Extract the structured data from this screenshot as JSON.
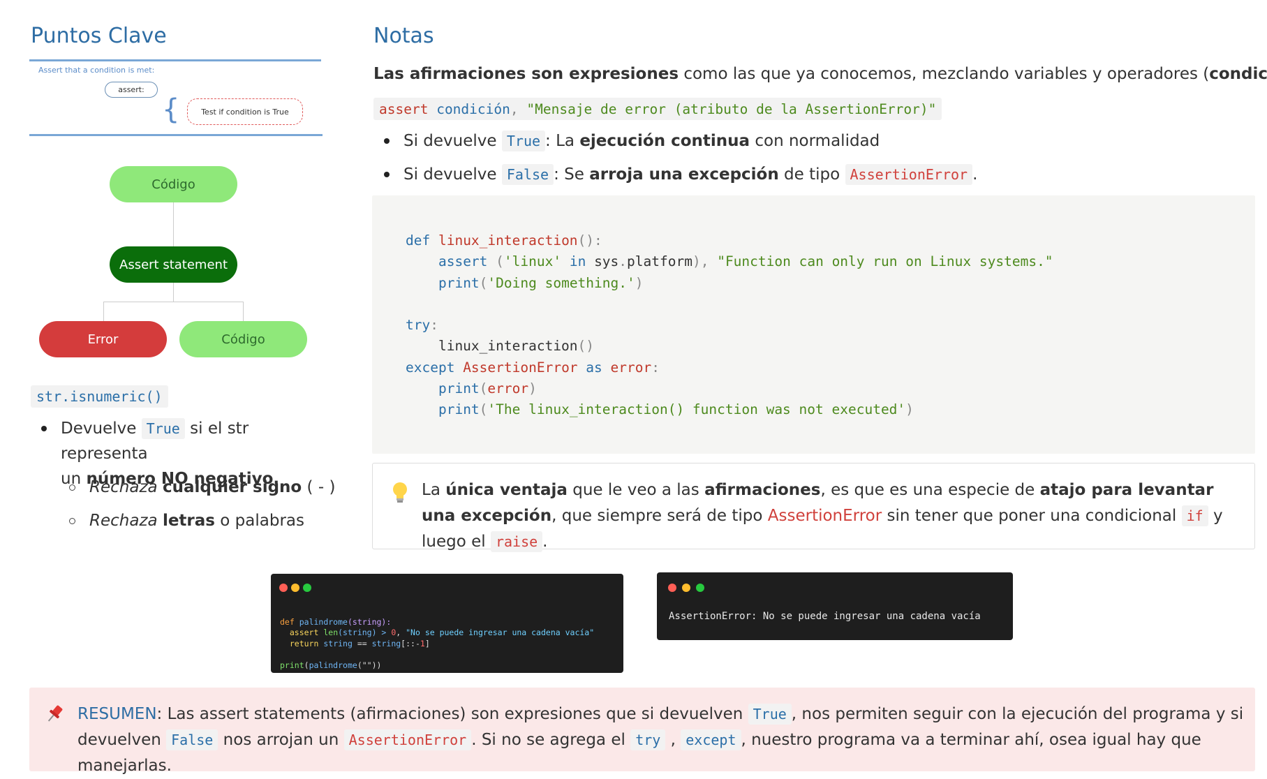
{
  "left": {
    "heading": "Puntos Clave",
    "diagram_top": {
      "caption": "Assert that a condition is met:",
      "assert_pill": "assert:",
      "brace": "{",
      "condition_box": "Test if condition is True"
    },
    "flow": {
      "top_node": "Código",
      "middle_node": "Assert statement",
      "left_node": "Error",
      "right_node": "Código"
    },
    "method": "str.isnumeric()",
    "bullet1": {
      "pre": "Devuelve",
      "code": "True",
      "post": "si el str representa",
      "line2_pre": "un",
      "line2_bold": "número NO negativo."
    },
    "sub1": {
      "italic": "Rechaza",
      "bold": "cualquier signo",
      "rest": "( - )"
    },
    "sub2": {
      "italic": "Rechaza",
      "bold": "letras",
      "rest": "o palabras"
    }
  },
  "right": {
    "heading": "Notas",
    "intro": {
      "bold1": "Las afirmaciones son expresiones",
      "text1": "como las que ya conocemos, mezclando variables y operadores (",
      "bold2": "condiciones",
      "text2": ")."
    },
    "syntax": {
      "kw": "assert",
      "cond": "condición",
      "comma": ",",
      "msg": "\"Mensaje de error (atributo de la AssertionError)\""
    },
    "bullet_true": {
      "pre": "Si devuelve",
      "code": "True",
      "colon": ": La",
      "bold": "ejecución continua",
      "post": "con normalidad"
    },
    "bullet_false": {
      "pre": "Si devuelve",
      "code": "False",
      "colon": ": Se",
      "bold": "arroja una excepción",
      "mid": "de tipo",
      "code2": "AssertionError",
      "post": "."
    },
    "tip": {
      "icon": "lightbulb-icon",
      "t1": "La",
      "b1": "única ventaja",
      "t2": "que le veo a las",
      "b2": "afirmaciones",
      "t3": ", es que es una especie de",
      "b3": "atajo para levantar una excepción",
      "t4": ",",
      "t5": "que siempre será de tipo",
      "red": "AssertionError",
      "t6": "sin tener que poner una condicional",
      "code1": "if",
      "t7": "y luego el",
      "code2": "raise",
      "t8": "."
    }
  },
  "terminal1": {
    "l1a": "def",
    "l1b": "palindrome",
    "l1c": "(string):",
    "l2a": "assert",
    "l2b": "len",
    "l2c": "(string) >",
    "l2d": "0",
    "l2e": ",",
    "l2f": "\"No se puede ingresar una cadena vacía\"",
    "l3a": "return",
    "l3b": "string",
    "l3c": "==",
    "l3d": "string",
    "l3e": "[::-",
    "l3f": "1",
    "l3g": "]",
    "l4a": "print",
    "l4b": "(",
    "l4c": "palindrome",
    "l4d": "(\"\"))"
  },
  "terminal2": {
    "output": "AssertionError: No se puede ingresar una cadena vacía"
  },
  "summary": {
    "icon": "pushpin-icon",
    "label": "RESUMEN",
    "t1": ": Las assert statements (afirmaciones) son expresiones que si devuelven",
    "c1": "True",
    "t2": ", nos permiten seguir con la ejecución del programa y si",
    "t3": "devuelven",
    "c2": "False",
    "t4": "nos arrojan un",
    "c3": "AssertionError",
    "t5": ". Si no se agrega el",
    "c4": "try",
    "t6": ",",
    "c5": "except",
    "t7": ", nuestro programa va a terminar ahí, osea igual hay que manejarlas."
  },
  "code": {
    "lines": [
      [
        [
          "kw",
          "def "
        ],
        [
          "fn",
          "linux_interaction"
        ],
        [
          "pn",
          "():"
        ]
      ],
      [
        [
          "",
          "    "
        ],
        [
          "kw",
          "assert "
        ],
        [
          "pn",
          "("
        ],
        [
          "str",
          "'linux'"
        ],
        [
          "kw",
          " in "
        ],
        [
          "",
          "sys"
        ],
        [
          "pn",
          "."
        ],
        [
          "",
          "platform"
        ],
        [
          "pn",
          "), "
        ],
        [
          "str",
          "\"Function can only run on Linux systems.\""
        ]
      ],
      [
        [
          "",
          "    "
        ],
        [
          "kw",
          "print"
        ],
        [
          "pn",
          "("
        ],
        [
          "str",
          "'Doing something.'"
        ],
        [
          "pn",
          ")"
        ]
      ],
      [
        [
          "",
          ""
        ]
      ],
      [
        [
          "kw",
          "try"
        ],
        [
          "pn",
          ":"
        ]
      ],
      [
        [
          "",
          "    linux_interaction"
        ],
        [
          "pn",
          "()"
        ]
      ],
      [
        [
          "kw",
          "except "
        ],
        [
          "fn",
          "AssertionError"
        ],
        [
          "kw",
          " as "
        ],
        [
          "fn",
          "error"
        ],
        [
          "pn",
          ":"
        ]
      ],
      [
        [
          "",
          "    "
        ],
        [
          "kw",
          "print"
        ],
        [
          "pn",
          "("
        ],
        [
          "fn",
          "error"
        ],
        [
          "pn",
          ")"
        ]
      ],
      [
        [
          "",
          "    "
        ],
        [
          "kw",
          "print"
        ],
        [
          "pn",
          "("
        ],
        [
          "str",
          "'The linux_interaction() function was not executed'"
        ],
        [
          "pn",
          ")"
        ]
      ]
    ]
  },
  "colors": {
    "heading": "#2e6da4",
    "light_green": "#8fe87a",
    "dark_green": "#0b6e0b",
    "error_red": "#d43c3c",
    "summary_bg": "#fbe8e8"
  }
}
